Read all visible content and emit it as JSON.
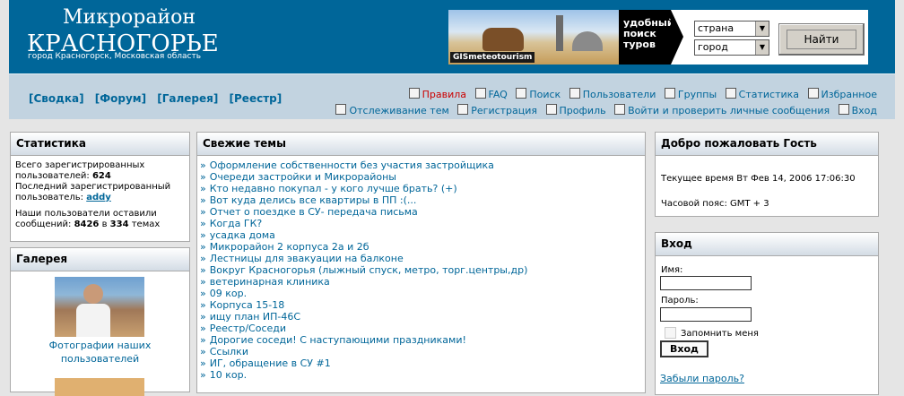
{
  "header": {
    "title_line1": "Микрорайон",
    "title_line2": "КРАСНОГОРЬЕ",
    "subtitle": "город Красногорск,  Московская область"
  },
  "banner": {
    "logo": "GISmeteotourism",
    "tagline": [
      "удобный",
      "поиск",
      "туров"
    ],
    "country_select": "страна",
    "city_select": "город",
    "find_button": "Найти"
  },
  "nav": {
    "left": [
      "[Сводка]",
      "[Форум]",
      "[Галерея]",
      "[Реестр]"
    ],
    "row1": [
      "Правила",
      "FAQ",
      "Поиск",
      "Пользователи",
      "Группы",
      "Статистика",
      "Избранное"
    ],
    "row2": [
      "Отслеживание тем",
      "Регистрация",
      "Профиль",
      "Войти и проверить личные сообщения",
      "Вход"
    ]
  },
  "stats": {
    "title": "Статистика",
    "line1": "Всего зарегистрированных",
    "line2_prefix": "пользователей: ",
    "users": "624",
    "line3": "Последний зарегистрированный",
    "line4_prefix": "пользователь: ",
    "last_user": "addy",
    "line5": "Наши пользователи оставили",
    "line6_prefix": "сообщений: ",
    "posts": "8426",
    "line6_mid": " в ",
    "topics_count": "334",
    "line6_suffix": " темах"
  },
  "gallery": {
    "title": "Галерея",
    "caption_line1": "Фотографии наших",
    "caption_line2": "пользователей"
  },
  "topics": {
    "title": "Свежие темы",
    "items": [
      "Оформление собственности без участия застройщика",
      "Очереди застройки и Микрорайоны",
      "Кто недавно покупал - у кого лучше брать? (+)",
      "Вот куда делись все квартиры в ПП :(...",
      "Отчет о поездке в СУ- передача письма",
      "Когда ГК?",
      "усадка дома",
      "Микрорайон 2 корпуса 2а и 2б",
      "Лестницы для эвакуации на балконе",
      "Вокруг Красногорья (лыжный спуск, метро, торг.центры,др)",
      "ветеринарная клиника",
      "09 кор.",
      "Корпуса 15-18",
      "ищу план ИП-46С",
      "Реестр/Соседи",
      "Дорогие соседи! С наступающими праздниками!",
      "Ссылки",
      "ИГ, обращение в СУ #1",
      "10 кор."
    ]
  },
  "welcome": {
    "title": "Добро пожаловать Гость",
    "time": "Текущее время Вт Фев 14, 2006 17:06:30",
    "tz": "Часовой пояс: GMT + 3"
  },
  "login": {
    "title": "Вход",
    "name_label": "Имя:",
    "password_label": "Пароль:",
    "remember": "Запомнить меня",
    "button": "Вход",
    "forgot": "Забыли пароль?"
  }
}
